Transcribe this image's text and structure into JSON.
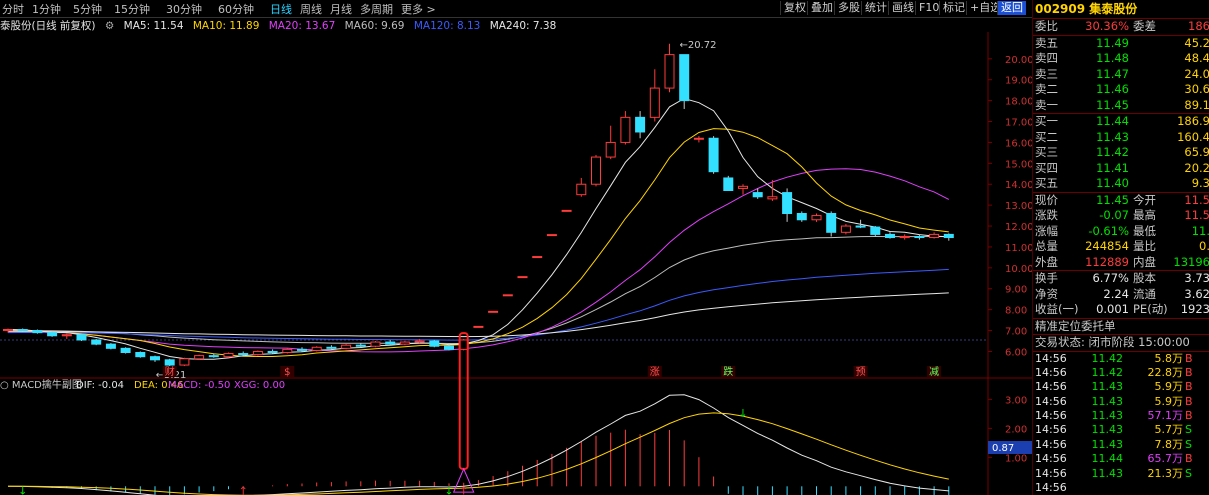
{
  "toolbar": {
    "timeframes": [
      "分时",
      "1分钟",
      "5分钟",
      "15分钟",
      "30分钟",
      "60分钟",
      "日线",
      "周线",
      "月线",
      "多周期",
      "更多 >"
    ],
    "active_timeframe": "日线",
    "buttons": [
      "复权",
      "叠加",
      "多股",
      "统计",
      "画线",
      "F10",
      "标记",
      "+自选",
      "返回"
    ]
  },
  "ma_bar": {
    "stock_label": "泰股份(日线 前复权)",
    "ma5": "MA5: 11.54",
    "ma10": "MA10: 11.89",
    "ma20": "MA20: 13.67",
    "ma60": "MA60: 9.69",
    "ma120": "MA120: 8.13",
    "ma240": "MA240: 7.38"
  },
  "colors": {
    "up": "#ff3b3b",
    "down": "#33e0ff",
    "ma5": "#e6e6e6",
    "ma10": "#ffd400",
    "ma20": "#e040fb",
    "ma60": "#bdbdbd",
    "ma120": "#3a5bff",
    "ma240": "#e6e6e6"
  },
  "chart_data": {
    "type": "candlestick",
    "y_ticks": [
      "20.00",
      "19.00",
      "18.00",
      "17.00",
      "16.00",
      "15.00",
      "14.00",
      "13.00",
      "12.00",
      "11.00",
      "10.00",
      "9.00",
      "8.00",
      "7.00",
      "6.00"
    ],
    "ylim": [
      5.4,
      20.9
    ],
    "high_label": "20.72",
    "low_label": "5.21",
    "candles": [
      [
        7.0,
        7.1,
        6.9,
        7.05
      ],
      [
        7.05,
        7.1,
        6.95,
        7.0
      ],
      [
        7.0,
        7.05,
        6.85,
        6.9
      ],
      [
        6.9,
        6.95,
        6.7,
        6.75
      ],
      [
        6.75,
        6.85,
        6.6,
        6.8
      ],
      [
        6.8,
        6.85,
        6.5,
        6.55
      ],
      [
        6.55,
        6.6,
        6.3,
        6.35
      ],
      [
        6.35,
        6.4,
        6.1,
        6.15
      ],
      [
        6.15,
        6.2,
        5.9,
        5.95
      ],
      [
        5.95,
        6.0,
        5.7,
        5.75
      ],
      [
        5.75,
        5.8,
        5.5,
        5.6
      ],
      [
        5.6,
        5.65,
        5.21,
        5.35
      ],
      [
        5.35,
        5.7,
        5.3,
        5.65
      ],
      [
        5.65,
        5.85,
        5.6,
        5.8
      ],
      [
        5.8,
        5.9,
        5.7,
        5.75
      ],
      [
        5.75,
        5.95,
        5.7,
        5.9
      ],
      [
        5.9,
        6.0,
        5.8,
        5.85
      ],
      [
        5.85,
        6.05,
        5.8,
        6.0
      ],
      [
        6.0,
        6.1,
        5.9,
        5.95
      ],
      [
        5.95,
        6.15,
        5.9,
        6.1
      ],
      [
        6.1,
        6.2,
        6.0,
        6.05
      ],
      [
        6.05,
        6.25,
        6.0,
        6.2
      ],
      [
        6.2,
        6.3,
        6.1,
        6.15
      ],
      [
        6.15,
        6.35,
        6.1,
        6.3
      ],
      [
        6.3,
        6.4,
        6.2,
        6.25
      ],
      [
        6.25,
        6.5,
        6.2,
        6.45
      ],
      [
        6.45,
        6.55,
        6.3,
        6.35
      ],
      [
        6.35,
        6.5,
        6.3,
        6.45
      ],
      [
        6.45,
        6.6,
        6.4,
        6.5
      ],
      [
        6.5,
        6.55,
        6.2,
        6.25
      ],
      [
        6.25,
        6.3,
        6.05,
        6.1
      ],
      [
        6.1,
        6.6,
        6.05,
        6.55
      ],
      [
        7.2,
        7.2,
        7.2,
        7.2
      ],
      [
        7.92,
        7.92,
        7.92,
        7.92
      ],
      [
        8.71,
        8.71,
        8.71,
        8.71
      ],
      [
        9.58,
        9.58,
        9.58,
        9.58
      ],
      [
        10.54,
        10.54,
        10.54,
        10.54
      ],
      [
        11.59,
        11.59,
        11.59,
        11.59
      ],
      [
        12.75,
        12.75,
        12.75,
        12.75
      ],
      [
        13.5,
        14.3,
        13.4,
        14.0
      ],
      [
        14.0,
        15.4,
        13.9,
        15.3
      ],
      [
        15.3,
        16.8,
        15.2,
        16.0
      ],
      [
        16.0,
        17.5,
        15.9,
        17.2
      ],
      [
        17.2,
        17.5,
        16.2,
        16.5
      ],
      [
        17.2,
        19.5,
        17.0,
        18.6
      ],
      [
        18.6,
        20.72,
        18.4,
        20.2
      ],
      [
        20.2,
        20.2,
        17.6,
        18.0
      ],
      [
        16.2,
        16.3,
        16.0,
        16.2
      ],
      [
        16.2,
        16.3,
        14.5,
        14.6
      ],
      [
        14.3,
        14.4,
        13.8,
        13.7
      ],
      [
        13.8,
        14.0,
        13.5,
        13.9
      ],
      [
        13.6,
        13.8,
        13.3,
        13.4
      ],
      [
        13.3,
        14.2,
        13.2,
        13.4
      ],
      [
        13.6,
        13.8,
        12.2,
        12.6
      ],
      [
        12.6,
        12.7,
        12.2,
        12.3
      ],
      [
        12.3,
        12.6,
        12.2,
        12.5
      ],
      [
        12.6,
        12.7,
        11.5,
        11.7
      ],
      [
        11.7,
        12.1,
        11.6,
        12.0
      ],
      [
        12.0,
        12.3,
        11.9,
        11.95
      ],
      [
        11.95,
        12.0,
        11.5,
        11.6
      ],
      [
        11.6,
        11.7,
        11.4,
        11.45
      ],
      [
        11.45,
        11.6,
        11.35,
        11.5
      ],
      [
        11.5,
        11.6,
        11.35,
        11.45
      ],
      [
        11.45,
        11.7,
        11.4,
        11.6
      ],
      [
        11.6,
        11.65,
        11.3,
        11.45
      ]
    ],
    "event_labels": [
      {
        "i": 11,
        "text": "财"
      },
      {
        "i": 19,
        "text": "$"
      },
      {
        "i": 44,
        "text": "涨"
      },
      {
        "i": 49,
        "text": "跌"
      },
      {
        "i": 58,
        "text": "预"
      },
      {
        "i": 63,
        "text": "减"
      }
    ],
    "macd": {
      "title": "MACD擒牛副图",
      "dif": "DIF: -0.04",
      "dea": "DEA: 0.46",
      "macd": "MACD: -0.50",
      "xgg": "XGG: 0.00",
      "y_ticks": [
        "3.00",
        "2.00",
        "1.00"
      ],
      "ylim": [
        -0.3,
        3.6
      ],
      "current_value": "0.87"
    }
  },
  "quote": {
    "code": "002909",
    "name": "集泰股份",
    "weibi_label": "委比",
    "weibi": "30.36%",
    "weicha_label": "委差",
    "weicha": "186",
    "asks": [
      {
        "label": "卖五",
        "price": "11.49",
        "vol": "45.2"
      },
      {
        "label": "卖四",
        "price": "11.48",
        "vol": "48.4"
      },
      {
        "label": "卖三",
        "price": "11.47",
        "vol": "24.0"
      },
      {
        "label": "卖二",
        "price": "11.46",
        "vol": "30.6"
      },
      {
        "label": "卖一",
        "price": "11.45",
        "vol": "89.1"
      }
    ],
    "bids": [
      {
        "label": "买一",
        "price": "11.44",
        "vol": "186.9"
      },
      {
        "label": "买二",
        "price": "11.43",
        "vol": "160.4"
      },
      {
        "label": "买三",
        "price": "11.42",
        "vol": "65.9"
      },
      {
        "label": "买四",
        "price": "11.41",
        "vol": "20.2"
      },
      {
        "label": "买五",
        "price": "11.40",
        "vol": "9.3"
      }
    ],
    "stats": [
      {
        "l1": "现价",
        "v1": "11.45",
        "c1": "green",
        "l2": "今开",
        "v2": "11.5",
        "c2": "red"
      },
      {
        "l1": "涨跌",
        "v1": "-0.07",
        "c1": "green",
        "l2": "最高",
        "v2": "11.5",
        "c2": "red"
      },
      {
        "l1": "涨幅",
        "v1": "-0.61%",
        "c1": "green",
        "l2": "最低",
        "v2": "11.",
        "c2": "green"
      },
      {
        "l1": "总量",
        "v1": "244854",
        "c1": "yellow",
        "l2": "量比",
        "v2": "0.",
        "c2": "yellow"
      },
      {
        "l1": "外盘",
        "v1": "112889",
        "c1": "red",
        "l2": "内盘",
        "v2": "13196",
        "c2": "green"
      }
    ],
    "stats2": [
      {
        "l1": "换手",
        "v1": "6.77%",
        "l2": "股本",
        "v2": "3.73"
      },
      {
        "l1": "净资",
        "v1": "2.24",
        "l2": "流通",
        "v2": "3.62"
      },
      {
        "l1": "收益(一)",
        "v1": "0.001",
        "l2": "PE(动)",
        "v2": "1923"
      }
    ],
    "section_title": "精准定位委托单",
    "status": "交易状态: 闭市阶段 15:00:00",
    "ticks": [
      {
        "t": "14:56",
        "p": "11.42",
        "v": "5.8万",
        "s": "B",
        "vc": "yellow",
        "sc": "red"
      },
      {
        "t": "14:56",
        "p": "11.42",
        "v": "22.8万",
        "s": "B",
        "vc": "yellow",
        "sc": "red"
      },
      {
        "t": "14:56",
        "p": "11.43",
        "v": "5.9万",
        "s": "B",
        "vc": "yellow",
        "sc": "red"
      },
      {
        "t": "14:56",
        "p": "11.43",
        "v": "5.9万",
        "s": "B",
        "vc": "yellow",
        "sc": "red"
      },
      {
        "t": "14:56",
        "p": "11.43",
        "v": "57.1万",
        "s": "B",
        "vc": "purple",
        "sc": "red"
      },
      {
        "t": "14:56",
        "p": "11.43",
        "v": "5.7万",
        "s": "S",
        "vc": "yellow",
        "sc": "green"
      },
      {
        "t": "14:56",
        "p": "11.43",
        "v": "7.8万",
        "s": "S",
        "vc": "yellow",
        "sc": "green"
      },
      {
        "t": "14:56",
        "p": "11.44",
        "v": "65.7万",
        "s": "B",
        "vc": "purple",
        "sc": "red"
      },
      {
        "t": "14:56",
        "p": "11.43",
        "v": "21.3万",
        "s": "S",
        "vc": "yellow",
        "sc": "green"
      },
      {
        "t": "14:56",
        "p": "",
        "v": "",
        "s": "",
        "vc": "yellow",
        "sc": "green"
      }
    ]
  }
}
